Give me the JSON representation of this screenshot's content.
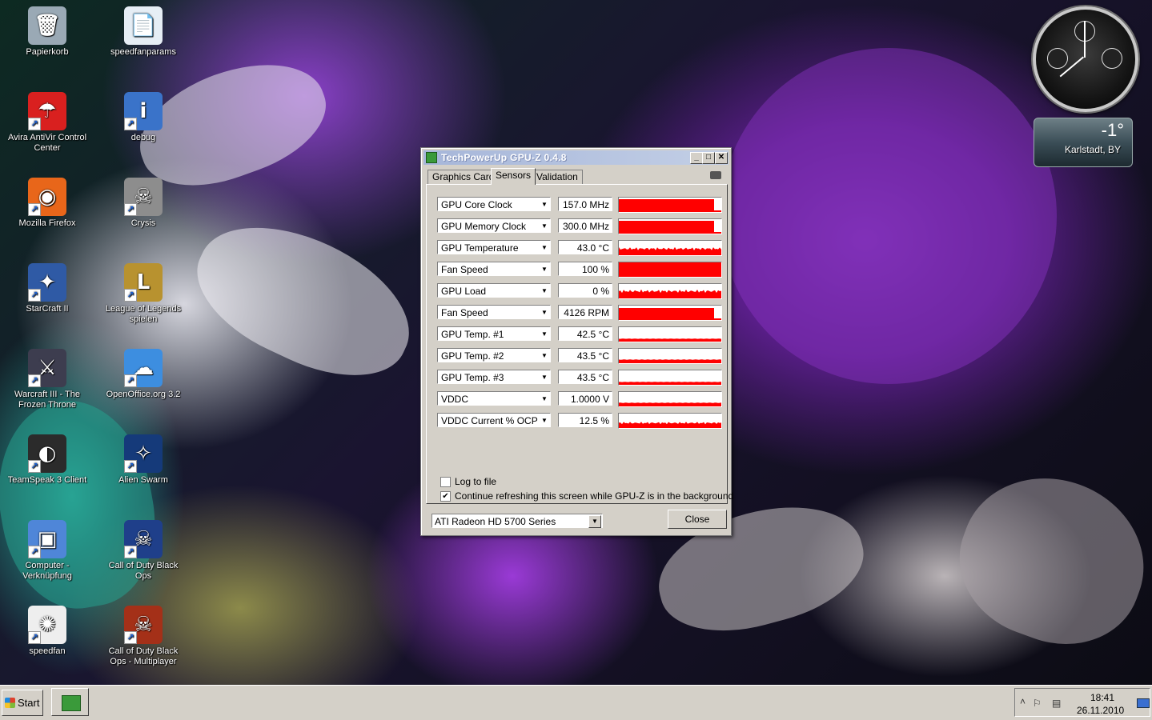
{
  "desktop": {
    "icons": [
      {
        "label": "Papierkorb",
        "icon": "recycle-bin-icon",
        "color": "#9aa9b5",
        "glyph": "🗑"
      },
      {
        "label": "speedfanparams",
        "icon": "document-icon",
        "color": "#e6eef5",
        "glyph": "📄"
      },
      {
        "label": "Avira AntiVir Control Center",
        "icon": "avira-icon",
        "color": "#d9201f",
        "glyph": "☂"
      },
      {
        "label": "debug",
        "icon": "debug-monitor-icon",
        "color": "#3a73c9",
        "glyph": "i"
      },
      {
        "label": "Mozilla Firefox",
        "icon": "firefox-icon",
        "color": "#e8661a",
        "glyph": "◉"
      },
      {
        "label": "Crysis",
        "icon": "crysis-icon",
        "color": "#8d8d8d",
        "glyph": "☠"
      },
      {
        "label": "StarCraft II",
        "icon": "starcraft-icon",
        "color": "#2f5aa5",
        "glyph": "✦"
      },
      {
        "label": "League of Legends spielen",
        "icon": "league-of-legends-icon",
        "color": "#b8922f",
        "glyph": "L"
      },
      {
        "label": "Warcraft III - The Frozen Throne",
        "icon": "warcraft-icon",
        "color": "#3d3d4f",
        "glyph": "⚔"
      },
      {
        "label": "OpenOffice.org 3.2",
        "icon": "openoffice-icon",
        "color": "#3d8ee0",
        "glyph": "☁"
      },
      {
        "label": "TeamSpeak 3 Client",
        "icon": "teamspeak-icon",
        "color": "#2b2b2b",
        "glyph": "◐"
      },
      {
        "label": "Alien Swarm",
        "icon": "alien-swarm-icon",
        "color": "#153a7a",
        "glyph": "✧"
      },
      {
        "label": "Computer - Verknüpfung",
        "icon": "computer-icon",
        "color": "#4f86d8",
        "glyph": "▣"
      },
      {
        "label": "Call of Duty Black Ops",
        "icon": "black-ops-icon",
        "color": "#1f3f8a",
        "glyph": "☠"
      },
      {
        "label": "speedfan",
        "icon": "speedfan-icon",
        "color": "#eeeeee",
        "glyph": "✺"
      },
      {
        "label": "Call of Duty Black Ops - Multiplayer",
        "icon": "black-ops-multiplayer-icon",
        "color": "#a43018",
        "glyph": "☠"
      }
    ]
  },
  "weather": {
    "temp": "-1°",
    "location": "Karlstadt, BY"
  },
  "gpuz": {
    "title": "TechPowerUp GPU-Z 0.4.8",
    "tabs": [
      "Graphics Card",
      "Sensors",
      "Validation"
    ],
    "active_tab": "Sensors",
    "sensors": [
      {
        "name": "GPU Core Clock",
        "value": "157.0 MHz",
        "level": 0.9,
        "style": "block"
      },
      {
        "name": "GPU Memory Clock",
        "value": "300.0 MHz",
        "level": 0.9,
        "style": "block"
      },
      {
        "name": "GPU Temperature",
        "value": "43.0 °C",
        "level": 0.45,
        "style": "noisy"
      },
      {
        "name": "Fan Speed",
        "value": "100 %",
        "level": 1.0,
        "style": "block"
      },
      {
        "name": "GPU Load",
        "value": "0 %",
        "level": 0.5,
        "style": "noisy"
      },
      {
        "name": "Fan Speed",
        "value": "4126 RPM",
        "level": 0.85,
        "style": "block"
      },
      {
        "name": "GPU Temp. #1",
        "value": "42.5 °C",
        "level": 0.2,
        "style": "thin"
      },
      {
        "name": "GPU Temp. #2",
        "value": "43.5 °C",
        "level": 0.25,
        "style": "thin"
      },
      {
        "name": "GPU Temp. #3",
        "value": "43.5 °C",
        "level": 0.2,
        "style": "thin"
      },
      {
        "name": "VDDC",
        "value": "1.0000 V",
        "level": 0.25,
        "style": "thin"
      },
      {
        "name": "VDDC Current % OCP",
        "value": "12.5 %",
        "level": 0.35,
        "style": "noisy"
      }
    ],
    "log_to_file": {
      "label": "Log to file",
      "checked": false
    },
    "continue_refresh": {
      "label": "Continue refreshing this screen while GPU-Z is in the background",
      "checked": true
    },
    "gpu_select": "ATI Radeon HD 5700 Series",
    "close_label": "Close",
    "bar_color": "#ff0000"
  },
  "taskbar": {
    "start_label": "Start",
    "time": "18:41",
    "date": "26.11.2010"
  }
}
